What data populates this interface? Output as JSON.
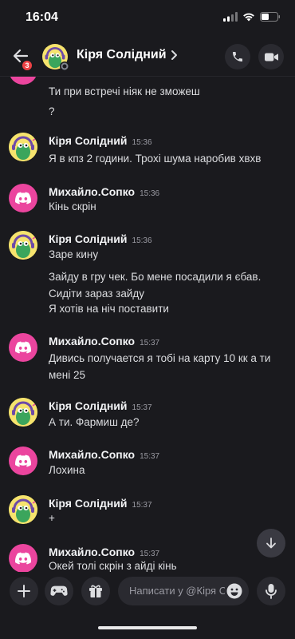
{
  "status": {
    "time": "16:04"
  },
  "header": {
    "title": "Кіря Солідний",
    "badge": "3"
  },
  "messages": [
    {
      "kind": "cont",
      "avatar": "discord",
      "lines": [
        "Ти при встречі ніяк не зможеш",
        "?"
      ]
    },
    {
      "kind": "msg",
      "avatar": "kirya",
      "name": "Кіря Солідний",
      "time": "15:36",
      "lines": [
        "Я в кпз 2 години. Трохі шума наробив хвхв"
      ]
    },
    {
      "kind": "msg",
      "avatar": "discord",
      "name": "Михайло.Сопко",
      "time": "15:36",
      "lines": [
        "Кінь скрін"
      ]
    },
    {
      "kind": "msg",
      "avatar": "kirya",
      "name": "Кіря Солідний",
      "time": "15:36",
      "lines": [
        "Заре кину",
        "Зайду в гру чек.   Бо мене посадили я єбав. Сидіти зараз зайду",
        "Я хотів на ніч поставити"
      ]
    },
    {
      "kind": "msg",
      "avatar": "discord",
      "name": "Михайло.Сопко",
      "time": "15:37",
      "lines": [
        "Дивись получается я тобі на карту 10 кк а ти мені 25"
      ]
    },
    {
      "kind": "msg",
      "avatar": "kirya",
      "name": "Кіря Солідний",
      "time": "15:37",
      "lines": [
        "А ти. Фармиш де?"
      ]
    },
    {
      "kind": "msg",
      "avatar": "discord",
      "name": "Михайло.Сопко",
      "time": "15:37",
      "lines": [
        "Лохина"
      ]
    },
    {
      "kind": "msg",
      "avatar": "kirya",
      "name": "Кіря Солідний",
      "time": "15:37",
      "lines": [
        "+"
      ]
    },
    {
      "kind": "msg",
      "avatar": "discord",
      "name": "Михайло.Сопко",
      "time": "15:37",
      "lines": [
        "Окей толі скрін з айді кінь"
      ]
    }
  ],
  "composer": {
    "placeholder": "Написати у @Кіря Солідний"
  },
  "colors": {
    "background": "#1a1a1e",
    "discord_pink": "#eb459e",
    "badge_red": "#ed4245",
    "kirya_yellow": "#f6e36d"
  },
  "icons": [
    "back-arrow-icon",
    "phone-icon",
    "video-camera-icon",
    "chevron-right-icon",
    "scroll-down-arrow-icon",
    "plus-icon",
    "gamepad-icon",
    "gift-icon",
    "emoji-icon",
    "microphone-icon"
  ]
}
